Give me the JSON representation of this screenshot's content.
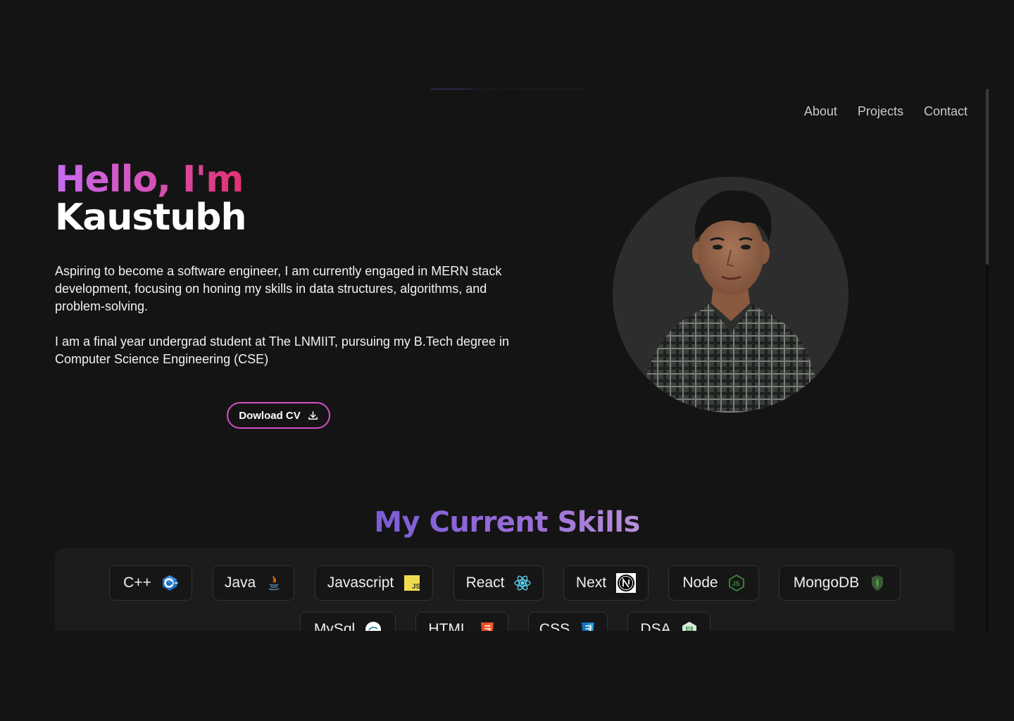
{
  "nav": {
    "items": [
      {
        "label": "About"
      },
      {
        "label": "Projects"
      },
      {
        "label": "Contact"
      }
    ]
  },
  "hero": {
    "greeting": "Hello, I'm",
    "name": "Kaustubh",
    "bio_1": "Aspiring to become a software engineer, I am currently engaged in MERN stack development, focusing on honing my skills in data structures, algorithms, and problem-solving.",
    "bio_2": "I am a final year undergrad student at The LNMIIT, pursuing my B.Tech degree in Computer Science Engineering (CSE)",
    "cv_button": "Dowload CV",
    "avatar_icon": "profile-photo"
  },
  "skills": {
    "title": "My Current Skills",
    "items": [
      {
        "label": "C++",
        "icon": "cpp-icon"
      },
      {
        "label": "Java",
        "icon": "java-icon"
      },
      {
        "label": "Javascript",
        "icon": "javascript-icon"
      },
      {
        "label": "React",
        "icon": "react-icon"
      },
      {
        "label": "Next",
        "icon": "nextjs-icon"
      },
      {
        "label": "Node",
        "icon": "nodejs-icon"
      },
      {
        "label": "MongoDB",
        "icon": "mongodb-icon"
      },
      {
        "label": "MySql",
        "icon": "mysql-icon"
      },
      {
        "label": "HTML",
        "icon": "html5-icon"
      },
      {
        "label": "CSS",
        "icon": "css3-icon"
      },
      {
        "label": "DSA",
        "icon": "dsa-icon"
      }
    ]
  },
  "colors": {
    "background": "#141414",
    "accent_pink": "#d44fc7",
    "accent_purple": "#7b5bd6"
  }
}
